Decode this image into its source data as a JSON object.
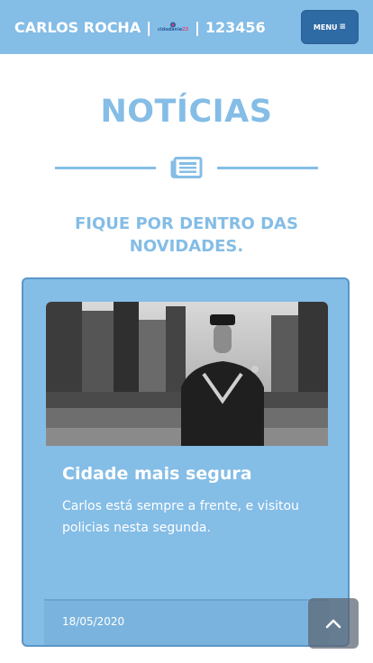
{
  "header": {
    "name": "CARLOS ROCHA",
    "separator": "|",
    "logo_text_primary": "cidadania",
    "logo_text_accent": "23",
    "number": "123456",
    "menu_label": "MENU",
    "menu_icon": "hamburger-icon"
  },
  "page": {
    "title": "NOTÍCIAS",
    "divider_icon": "newspaper-icon",
    "subtitle": "FIQUE POR DENTRO DAS NOVIDADES."
  },
  "news": [
    {
      "image": "police-officer-photo",
      "title": "Cidade mais segura",
      "text": "Carlos está sempre a frente, e visitou policias nesta segunda.",
      "date": "18/05/2020"
    }
  ],
  "back_to_top": {
    "icon": "chevron-up-icon"
  },
  "colors": {
    "primary": "#84bde6",
    "menu_button": "#2e6aa3",
    "logo_blue": "#2d5f9e",
    "logo_pink": "#e0457b",
    "back_to_top": "#5a6470"
  }
}
